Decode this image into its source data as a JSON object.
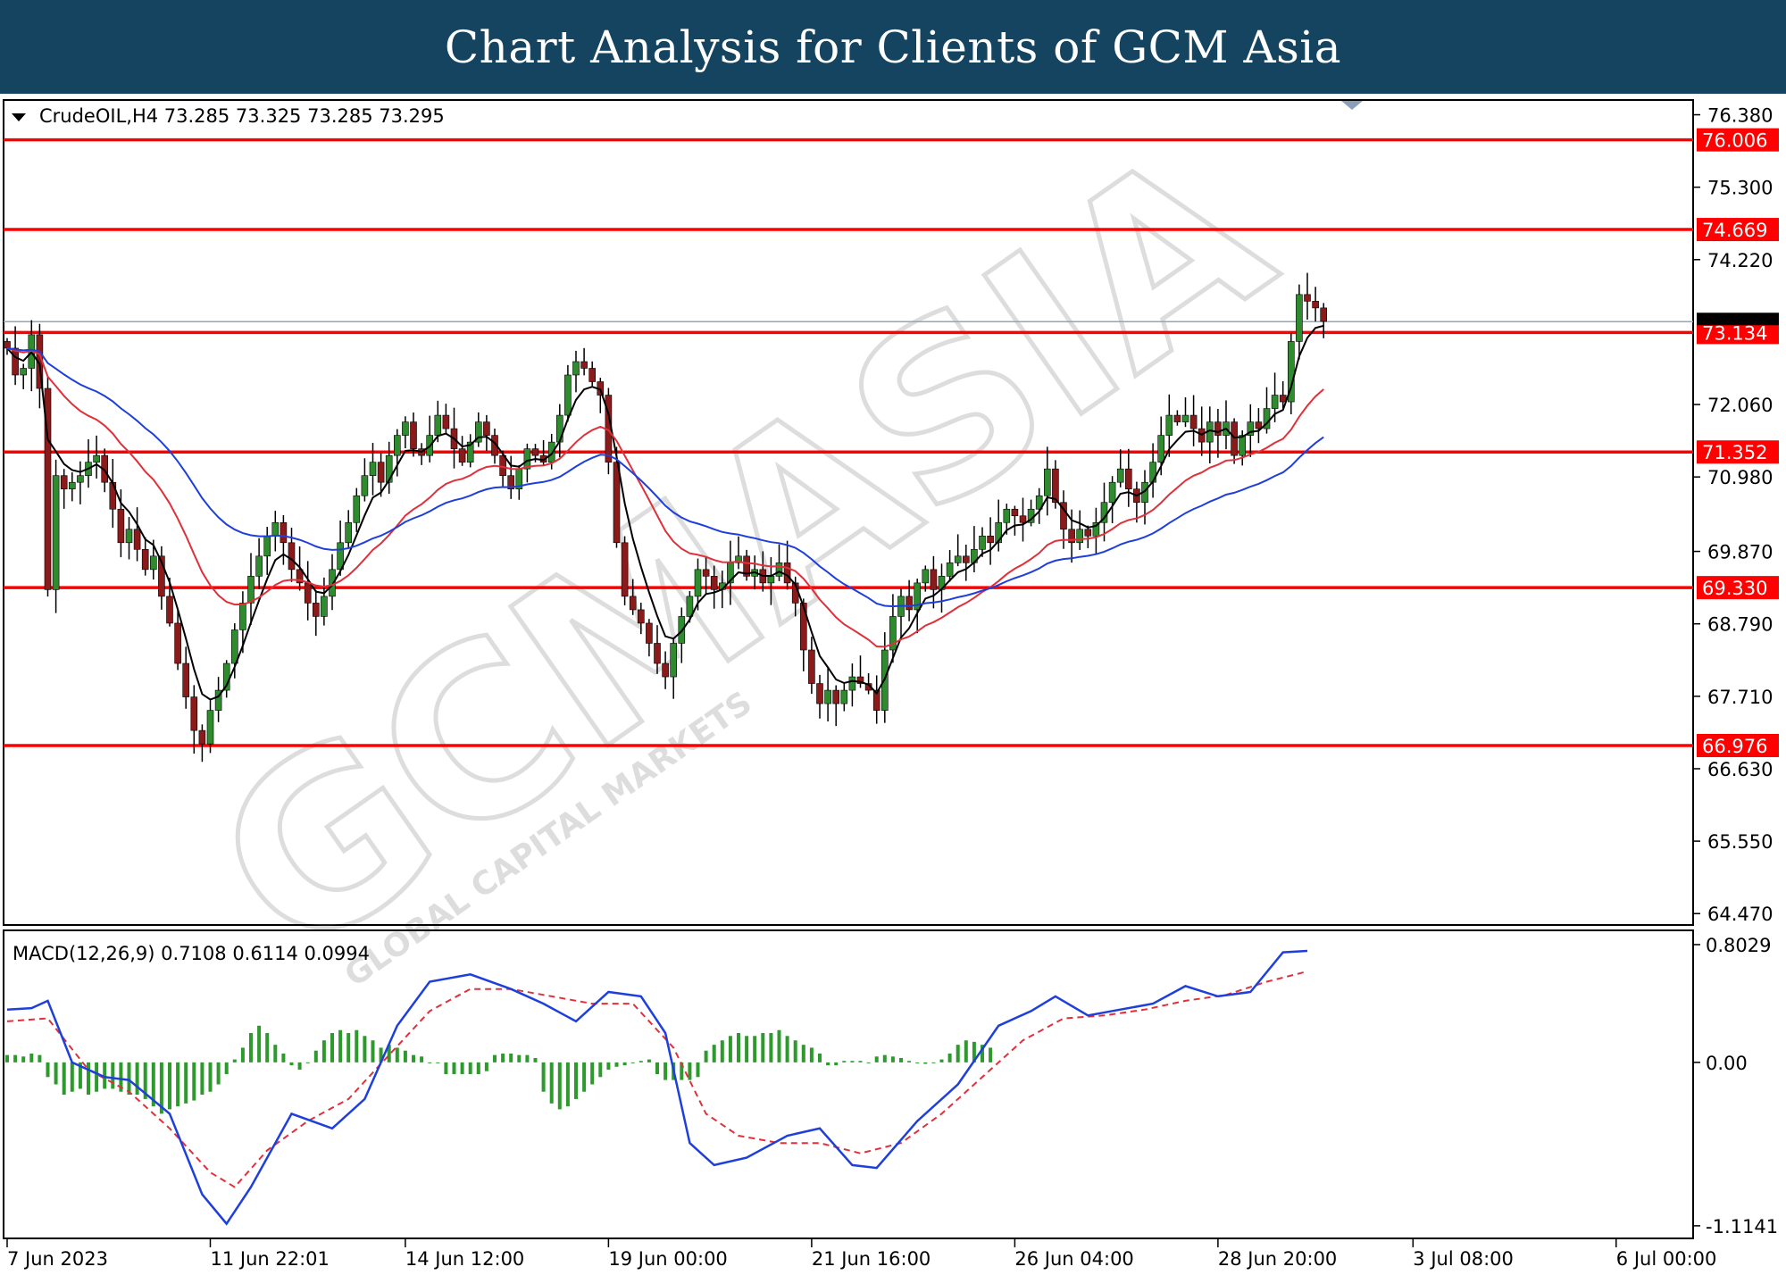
{
  "banner": {
    "title": "Chart Analysis for Clients of GCM Asia"
  },
  "instrument": {
    "label": "CrudeOIL,H4  73.285 73.325 73.285 73.295",
    "menu_icon": "triangle-down-icon"
  },
  "watermark": {
    "main": "GCMASIA",
    "sub": "GLOBAL CAPITAL MARKETS"
  },
  "colors": {
    "banner": "#14445f",
    "level_line": "#ff0000",
    "bull_candle": "#2e8b2e",
    "bear_candle": "#8b1a1a",
    "ma_fast": "#000000",
    "ma_mid": "#e0303a",
    "ma_slow": "#1f3fdc",
    "macd_line": "#1f3fdc",
    "macd_signal": "#e0303a",
    "macd_hist": "#2e9a2e"
  },
  "chart_data": [
    {
      "type": "candlestick",
      "title": "CrudeOIL,H4",
      "ohlc_label": "73.285 73.325 73.285 73.295",
      "ylim": [
        64.3,
        76.6
      ],
      "y_ticks": [
        "76.380",
        "75.300",
        "74.220",
        "72.060",
        "70.980",
        "69.870",
        "68.790",
        "67.710",
        "66.630",
        "65.550",
        "64.470"
      ],
      "x_ticks": [
        "7 Jun 2023",
        "11 Jun 22:01",
        "14 Jun 12:00",
        "19 Jun 00:00",
        "21 Jun 16:00",
        "26 Jun 04:00",
        "28 Jun 20:00",
        "3 Jul 08:00",
        "6 Jul 00:00"
      ],
      "x_tick_bars": [
        0,
        25,
        49,
        74,
        99,
        124,
        149,
        173,
        198
      ],
      "levels": [
        "76.006",
        "74.669",
        "73.134",
        "71.352",
        "69.330",
        "66.976"
      ],
      "current_price": 73.295,
      "close": [
        72.9,
        72.5,
        72.6,
        73.1,
        72.3,
        69.3,
        71.0,
        70.8,
        70.9,
        71.0,
        71.2,
        71.3,
        70.9,
        70.5,
        70.0,
        70.2,
        69.9,
        69.6,
        69.8,
        69.2,
        68.8,
        68.2,
        67.7,
        67.2,
        67.0,
        67.5,
        67.8,
        68.2,
        68.7,
        69.1,
        69.5,
        69.8,
        70.1,
        70.3,
        70.0,
        69.6,
        69.4,
        69.1,
        68.9,
        69.2,
        69.6,
        70.0,
        70.3,
        70.7,
        71.0,
        71.2,
        70.9,
        71.3,
        71.6,
        71.8,
        71.4,
        71.3,
        71.6,
        71.9,
        71.7,
        71.4,
        71.2,
        71.5,
        71.8,
        71.6,
        71.3,
        71.0,
        70.8,
        71.1,
        71.4,
        71.3,
        71.2,
        71.5,
        71.9,
        72.5,
        72.7,
        72.6,
        72.4,
        72.2,
        71.2,
        70.0,
        69.2,
        69.0,
        68.8,
        68.5,
        68.2,
        68.0,
        68.5,
        68.9,
        69.2,
        69.6,
        69.5,
        69.3,
        69.4,
        69.7,
        69.8,
        69.5,
        69.6,
        69.4,
        69.5,
        69.7,
        69.4,
        69.1,
        68.4,
        67.9,
        67.6,
        67.8,
        67.6,
        67.8,
        68.0,
        67.9,
        67.8,
        67.5,
        68.4,
        68.9,
        69.2,
        69.0,
        69.4,
        69.6,
        69.3,
        69.5,
        69.7,
        69.8,
        69.7,
        69.9,
        70.1,
        70.0,
        70.3,
        70.5,
        70.4,
        70.3,
        70.5,
        70.7,
        71.1,
        70.6,
        70.2,
        70.0,
        70.2,
        70.1,
        70.3,
        70.6,
        70.9,
        71.1,
        70.8,
        70.6,
        70.9,
        71.2,
        71.6,
        71.9,
        71.8,
        71.9,
        71.7,
        71.5,
        71.8,
        71.6,
        71.8,
        71.3,
        71.6,
        71.8,
        71.7,
        72.0,
        72.2,
        72.1,
        73.0,
        73.7,
        73.6,
        73.5,
        73.3
      ]
    },
    {
      "type": "macd",
      "title": "MACD(12,26,9) 0.7108 0.6114 0.0994",
      "params": "12,26,9",
      "values": {
        "macd": 0.7108,
        "signal": 0.6114,
        "histogram": 0.0994
      },
      "ylim": [
        -1.2,
        0.9
      ],
      "y_ticks": [
        "0.8029",
        "0.00",
        "-1.1141"
      ],
      "macd_line": [
        [
          0,
          0.36
        ],
        [
          3,
          0.37
        ],
        [
          5,
          0.42
        ],
        [
          8,
          0.0
        ],
        [
          12,
          -0.1
        ],
        [
          15,
          -0.12
        ],
        [
          20,
          -0.35
        ],
        [
          24,
          -0.9
        ],
        [
          27,
          -1.1
        ],
        [
          30,
          -0.85
        ],
        [
          35,
          -0.35
        ],
        [
          40,
          -0.45
        ],
        [
          44,
          -0.25
        ],
        [
          48,
          0.25
        ],
        [
          52,
          0.55
        ],
        [
          57,
          0.6
        ],
        [
          62,
          0.5
        ],
        [
          66,
          0.4
        ],
        [
          70,
          0.28
        ],
        [
          74,
          0.48
        ],
        [
          78,
          0.45
        ],
        [
          81,
          0.2
        ],
        [
          84,
          -0.55
        ],
        [
          87,
          -0.7
        ],
        [
          91,
          -0.65
        ],
        [
          96,
          -0.5
        ],
        [
          100,
          -0.45
        ],
        [
          104,
          -0.7
        ],
        [
          107,
          -0.72
        ],
        [
          112,
          -0.4
        ],
        [
          117,
          -0.15
        ],
        [
          122,
          0.25
        ],
        [
          126,
          0.35
        ],
        [
          129,
          0.45
        ],
        [
          133,
          0.32
        ],
        [
          137,
          0.36
        ],
        [
          141,
          0.4
        ],
        [
          145,
          0.52
        ],
        [
          149,
          0.45
        ],
        [
          153,
          0.48
        ],
        [
          157,
          0.75
        ],
        [
          160,
          0.76
        ]
      ],
      "signal_line": [
        [
          0,
          0.28
        ],
        [
          5,
          0.3
        ],
        [
          10,
          -0.05
        ],
        [
          15,
          -0.2
        ],
        [
          20,
          -0.45
        ],
        [
          25,
          -0.75
        ],
        [
          28,
          -0.85
        ],
        [
          32,
          -0.6
        ],
        [
          37,
          -0.4
        ],
        [
          42,
          -0.25
        ],
        [
          47,
          0.05
        ],
        [
          52,
          0.35
        ],
        [
          57,
          0.5
        ],
        [
          62,
          0.5
        ],
        [
          67,
          0.45
        ],
        [
          72,
          0.4
        ],
        [
          77,
          0.4
        ],
        [
          82,
          0.1
        ],
        [
          86,
          -0.35
        ],
        [
          90,
          -0.5
        ],
        [
          95,
          -0.55
        ],
        [
          100,
          -0.55
        ],
        [
          105,
          -0.62
        ],
        [
          110,
          -0.55
        ],
        [
          115,
          -0.35
        ],
        [
          120,
          -0.1
        ],
        [
          125,
          0.15
        ],
        [
          130,
          0.3
        ],
        [
          135,
          0.32
        ],
        [
          140,
          0.36
        ],
        [
          145,
          0.42
        ],
        [
          150,
          0.46
        ],
        [
          155,
          0.55
        ],
        [
          160,
          0.62
        ]
      ],
      "histogram": [
        0.05,
        0.05,
        0.04,
        0.06,
        0.05,
        -0.1,
        -0.15,
        -0.22,
        -0.2,
        -0.18,
        -0.22,
        -0.2,
        -0.18,
        -0.18,
        -0.2,
        -0.22,
        -0.22,
        -0.25,
        -0.3,
        -0.35,
        -0.32,
        -0.3,
        -0.28,
        -0.26,
        -0.22,
        -0.2,
        -0.15,
        -0.08,
        0.02,
        0.1,
        0.2,
        0.25,
        0.2,
        0.12,
        0.06,
        -0.02,
        -0.05,
        0.0,
        0.08,
        0.15,
        0.2,
        0.22,
        0.2,
        0.22,
        0.18,
        0.15,
        0.1,
        0.12,
        0.1,
        0.08,
        0.05,
        0.04,
        0.0,
        0.0,
        -0.08,
        -0.08,
        -0.08,
        -0.08,
        -0.08,
        -0.06,
        0.05,
        0.06,
        0.06,
        0.05,
        0.05,
        0.03,
        -0.2,
        -0.28,
        -0.32,
        -0.3,
        -0.25,
        -0.2,
        -0.15,
        -0.1,
        -0.05,
        -0.03,
        -0.02,
        0.0,
        0.01,
        0.02,
        -0.08,
        -0.12,
        -0.12,
        -0.12,
        -0.12,
        -0.1,
        0.08,
        0.12,
        0.15,
        0.18,
        0.2,
        0.18,
        0.18,
        0.2,
        0.2,
        0.22,
        0.18,
        0.15,
        0.12,
        0.1,
        0.06,
        -0.02,
        -0.02,
        0.01,
        0.01,
        0.01,
        0.0,
        0.04,
        0.05,
        0.04,
        0.03,
        0.01,
        0.0,
        -0.01,
        0.0,
        0.02,
        0.06,
        0.12,
        0.15,
        0.14,
        0.12,
        0.1
      ]
    }
  ]
}
